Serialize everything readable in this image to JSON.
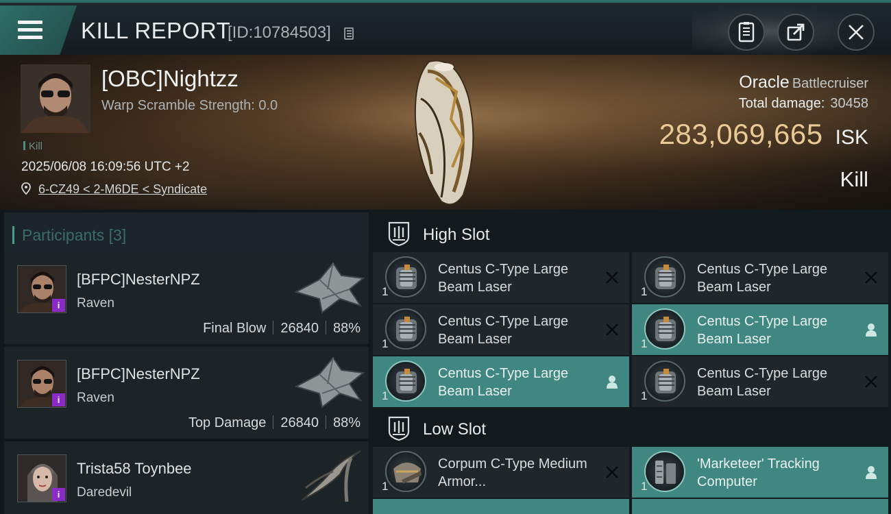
{
  "header": {
    "title": "KILL REPORT",
    "kill_id": "[ID:10784503]",
    "icons": [
      "menu-icon",
      "copy-icon",
      "report-icon",
      "share-icon",
      "close-icon"
    ]
  },
  "victim": {
    "name": "[OBC]Nightzz",
    "warp_scramble": "Warp Scramble Strength: 0.0",
    "tag": "Kill",
    "datetime": "2025/06/08 16:09:56 UTC +2",
    "location": "6-CZ49 < 2-M6DE < Syndicate",
    "ship_name": "Oracle",
    "ship_class": "Battlecruiser",
    "total_damage_label": "Total damage:",
    "total_damage_value": "30458",
    "isk_amount": "283,069,665",
    "isk_currency": "ISK",
    "result": "Kill"
  },
  "participants": {
    "label": "Participants",
    "count": "[3]",
    "items": [
      {
        "name": "[BFPC]NesterNPZ",
        "ship": "Raven",
        "role": "Final Blow",
        "damage": "26840",
        "percent": "88%",
        "badge": "i"
      },
      {
        "name": "[BFPC]NesterNPZ",
        "ship": "Raven",
        "role": "Top Damage",
        "damage": "26840",
        "percent": "88%",
        "badge": "i"
      },
      {
        "name": "Trista58 Toynbee",
        "ship": "Daredevil",
        "badge": "i"
      }
    ]
  },
  "high_slot": {
    "title": "High Slot",
    "modules": [
      {
        "name": "Centus C-Type Large Beam Laser",
        "qty": "1",
        "status": "destroyed"
      },
      {
        "name": "Centus C-Type Large Beam Laser",
        "qty": "1",
        "status": "destroyed"
      },
      {
        "name": "Centus C-Type Large Beam Laser",
        "qty": "1",
        "status": "destroyed"
      },
      {
        "name": "Centus C-Type Large Beam Laser",
        "qty": "1",
        "status": "dropped"
      },
      {
        "name": "Centus C-Type Large Beam Laser",
        "qty": "1",
        "status": "dropped"
      },
      {
        "name": "Centus C-Type Large Beam Laser",
        "qty": "1",
        "status": "destroyed"
      }
    ]
  },
  "low_slot": {
    "title": "Low Slot",
    "modules": [
      {
        "name": "Corpum C-Type Medium Armor...",
        "qty": "1",
        "status": "destroyed"
      },
      {
        "name": "'Marketeer' Tracking Computer",
        "qty": "1",
        "status": "dropped"
      }
    ]
  },
  "colors": {
    "accent": "#3f8780",
    "isk": "#e9c995",
    "badge": "#8b2bc6",
    "header_bar": "#2e6e68"
  }
}
